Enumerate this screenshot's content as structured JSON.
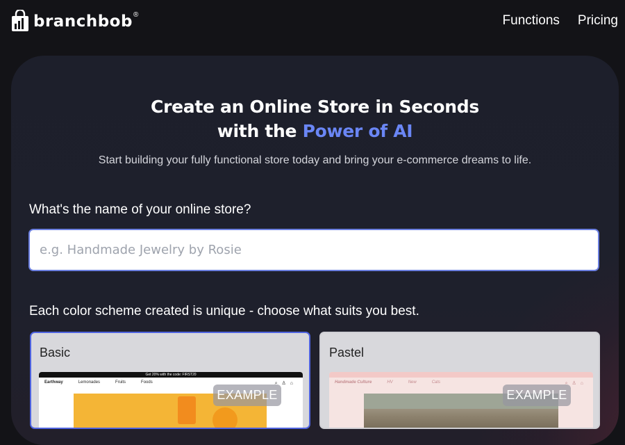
{
  "brand": {
    "name": "branchbob",
    "registered_mark": "®"
  },
  "nav": {
    "items": [
      "Functions",
      "Pricing"
    ]
  },
  "hero": {
    "title_line1": "Create an Online Store in Seconds",
    "title_line2_prefix": "with the ",
    "title_line2_accent": "Power of AI",
    "subtitle": "Start building your fully functional store today and bring your e-commerce dreams to life."
  },
  "store_name": {
    "question": "What's the name of your online store?",
    "placeholder": "e.g. Handmade Jewelry by Rosie",
    "value": ""
  },
  "color_schemes": {
    "prompt": "Each color scheme created is unique - choose what suits you best.",
    "options": [
      {
        "name": "Basic",
        "badge": "EXAMPLE",
        "selected": true,
        "preview": {
          "banner": "Get 20% with the code: FIRST20",
          "shop_name": "Earthway",
          "nav": [
            "Lemonades",
            "Fruits",
            "Foods"
          ]
        }
      },
      {
        "name": "Pastel",
        "badge": "EXAMPLE",
        "selected": false,
        "preview": {
          "banner": "",
          "shop_name": "Handmade Culture",
          "nav": [
            "HV",
            "New",
            "Cats"
          ]
        }
      }
    ]
  },
  "colors": {
    "accent": "#6a86f5",
    "selected_border": "#4f63e0",
    "background": "#131317",
    "card": "#1d1f2b"
  }
}
